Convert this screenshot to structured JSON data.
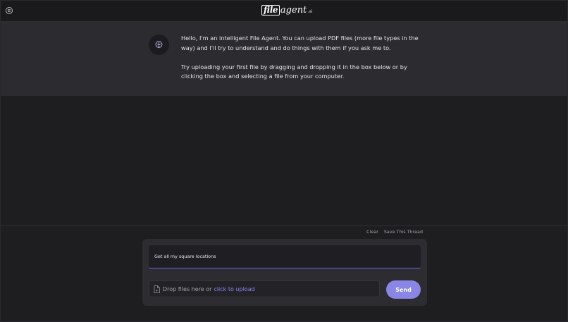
{
  "header": {
    "logo_file": "file",
    "logo_agent": "agent",
    "logo_ai": ".ai",
    "menu_icon": "circle-menu-icon"
  },
  "message": {
    "avatar_icon": "brain-icon",
    "paragraph_1": "Hello, I'm an intelligent File Agent. You can upload PDF files (more file types in the way) and I'll try to understand and do things with them if you ask me to.",
    "paragraph_2": "Try uploading your first file by dragging and dropping it in the box below or by clicking the box and selecting a file from your computer."
  },
  "thread_actions": {
    "clear_label": "Clear",
    "save_label": "Save This Thread"
  },
  "composer": {
    "input_value": "Get all my square locations",
    "drop_text": "Drop files here or",
    "upload_link": "click to upload",
    "file_icon": "file-icon",
    "send_label": "Send"
  },
  "colors": {
    "accent": "#8a86e6",
    "link": "#8a83f0",
    "background": "#1e1e21",
    "message_band": "#2b2b30"
  }
}
